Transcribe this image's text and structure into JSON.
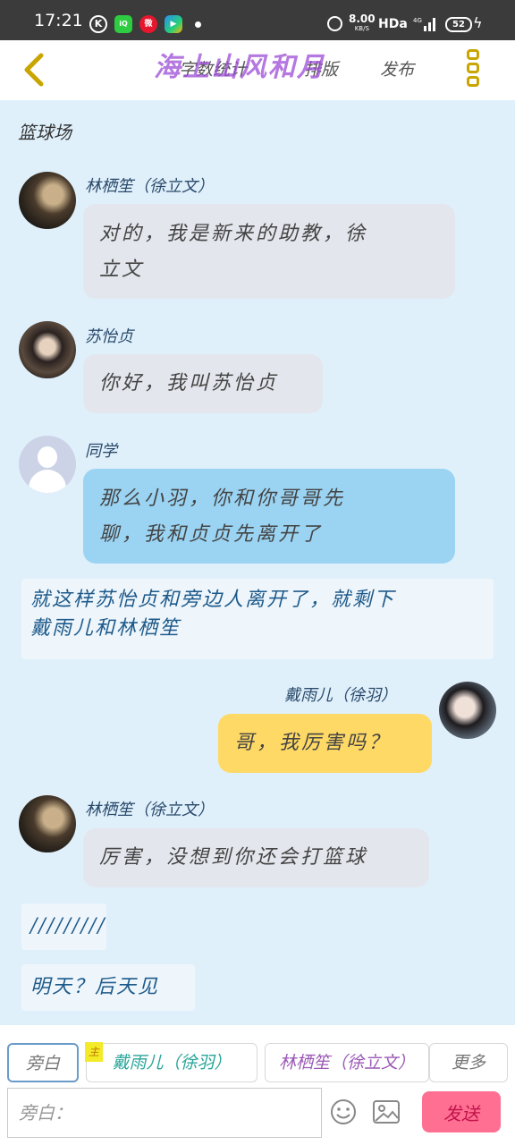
{
  "status_bar": {
    "time": "17:21",
    "network_speed": "8.00",
    "network_unit": "KB/S",
    "hd": "HDa",
    "net_type": "4G",
    "battery": "52"
  },
  "header": {
    "tabs": [
      "字数统计",
      "排版",
      "发布"
    ],
    "watermark": "海上山风和月"
  },
  "chat": {
    "scene_title": "篮球场",
    "messages": [
      {
        "speaker": "林栖笙（徐立文）",
        "text_lines": [
          "对的，我是新来的助教，徐",
          "立文"
        ]
      },
      {
        "speaker": "苏怡贞",
        "text_lines": [
          "你好，我叫苏怡贞"
        ]
      },
      {
        "speaker": "同学",
        "text_lines": [
          "那么小羽，你和你哥哥先",
          "聊，我和贞贞先离开了"
        ]
      },
      {
        "narration_lines": [
          "就这样苏怡贞和旁边人离开了，就剩下",
          "戴雨儿和林栖笙"
        ]
      },
      {
        "speaker": "戴雨儿（徐羽）",
        "text_lines": [
          "哥，我厉害吗？"
        ]
      },
      {
        "speaker": "林栖笙（徐立文）",
        "text_lines": [
          "厉害，没想到你还会打篮球"
        ]
      },
      {
        "narration_lines": [
          "/////////"
        ]
      },
      {
        "narration_lines": [
          "明天？后天见"
        ]
      }
    ]
  },
  "bottom_bar": {
    "roles": [
      "旁白",
      "戴雨儿（徐羽）",
      "林栖笙（徐立文）",
      "更多"
    ],
    "protagonist_badge": "主",
    "input_placeholder": "旁白：",
    "send_label": "发送"
  },
  "colors": {
    "chat_background": "#dff0fb",
    "bubble_gray": "#e3e6ec",
    "bubble_blue": "#9bd4f3",
    "bubble_yellow": "#ffd966",
    "send_button": "#ff6f92",
    "watermark": "#9b4bd6"
  }
}
